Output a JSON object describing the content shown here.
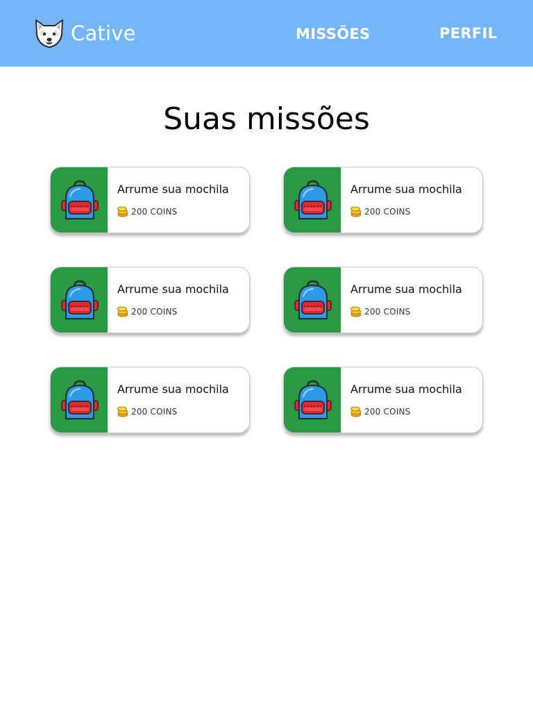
{
  "app": {
    "brand_name": "Cative",
    "logo_icon": "dog-face-icon"
  },
  "nav": {
    "items": [
      {
        "label": "MISSÕES"
      },
      {
        "label": "PERFIL"
      }
    ]
  },
  "colors": {
    "header_background": "#74b6fc",
    "card_icon_panel": "#2a9a45",
    "backpack_body": "#2f9be8",
    "backpack_pocket": "#e8262d",
    "coin": "#f7c326"
  },
  "page": {
    "title": "Suas missões"
  },
  "missions": [
    {
      "title": "Arrume sua mochila",
      "reward": "200 COINS",
      "icon": "backpack-icon",
      "reward_icon": "coins-icon"
    },
    {
      "title": "Arrume sua mochila",
      "reward": "200 COINS",
      "icon": "backpack-icon",
      "reward_icon": "coins-icon"
    },
    {
      "title": "Arrume sua mochila",
      "reward": "200 COINS",
      "icon": "backpack-icon",
      "reward_icon": "coins-icon"
    },
    {
      "title": "Arrume sua mochila",
      "reward": "200 COINS",
      "icon": "backpack-icon",
      "reward_icon": "coins-icon"
    },
    {
      "title": "Arrume sua mochila",
      "reward": "200 COINS",
      "icon": "backpack-icon",
      "reward_icon": "coins-icon"
    },
    {
      "title": "Arrume sua mochila",
      "reward": "200 COINS",
      "icon": "backpack-icon",
      "reward_icon": "coins-icon"
    }
  ]
}
